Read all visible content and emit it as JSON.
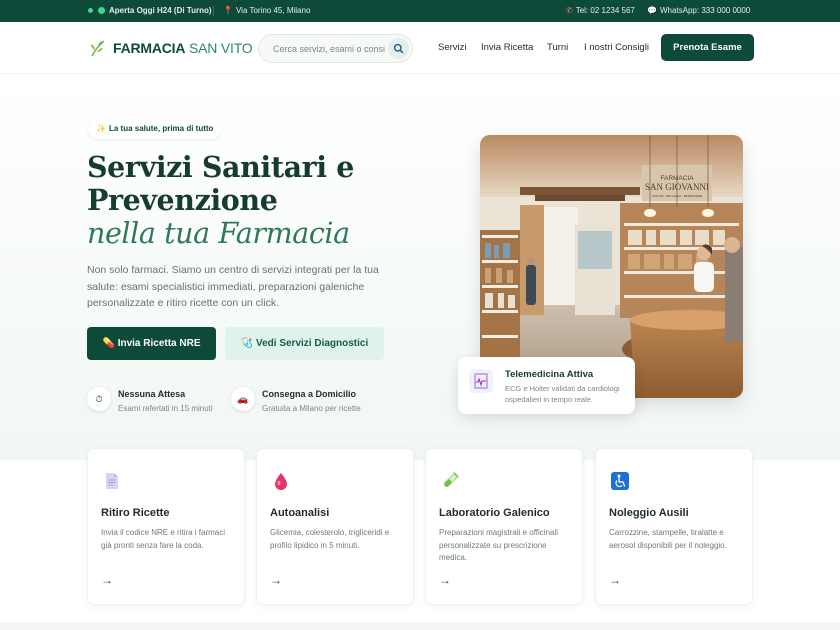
{
  "topbar": {
    "status": "Aperta Oggi H24 (Di Turno)",
    "address": "Via Torino 45, Milano",
    "phone": "Tel: 02 1234 567",
    "whatsapp": "WhatsApp: 333 000 0000"
  },
  "header": {
    "logo_bold": "FARMACIA",
    "logo_light": "SAN VITO",
    "search_placeholder": "Cerca servizi, esami o consigli...",
    "nav": [
      "Servizi",
      "Invia Ricetta",
      "Turni",
      "I nostri Consigli"
    ],
    "cta": "Prenota Esame"
  },
  "hero": {
    "pill": "La tua salute, prima di tutto",
    "title_line1": "Servizi Sanitari e",
    "title_line2": "Prevenzione",
    "title_italic": "nella tua Farmacia",
    "lead": "Non solo farmaci. Siamo un centro di servizi integrati per la tua salute: esami specialistici immediati, preparazioni galeniche personalizzate e ritiro ricette con un click.",
    "primary_button": "Invia Ricetta NRE",
    "secondary_button": "Vedi Servizi Diagnostici",
    "features": [
      {
        "title": "Nessuna Attesa",
        "subtitle": "Esami refertati in 15 minuti",
        "icon": "stopwatch-icon"
      },
      {
        "title": "Consegna a Domicilio",
        "subtitle": "Gratuita a Milano per ricette",
        "icon": "car-icon"
      }
    ],
    "photo_sign_line1": "FARMACIA",
    "photo_sign_line2": "SAN GIOVANNI",
    "photo_sign_line3": "SALUTE · BELLEZZA · BENESSERE",
    "card_title": "Telemedicina Attiva",
    "card_text": "ECG e Holter validati da cardiologi ospedalieri in tempo reale."
  },
  "services": [
    {
      "title": "Ritiro Ricette",
      "desc": "Invia il codice NRE e ritira i farmaci già pronti senza fare la coda.",
      "icon": "document-icon",
      "arrow": "→"
    },
    {
      "title": "Autoanalisi",
      "desc": "Glicemia, colesterolo, trigliceridi e profilo lipidico in 5 minuti.",
      "icon": "blood-drop-icon",
      "arrow": "→"
    },
    {
      "title": "Laboratorio Galenico",
      "desc": "Preparazioni magistrali e officinali personalizzate su prescrizione medica.",
      "icon": "test-tube-icon",
      "arrow": "→"
    },
    {
      "title": "Noleggio Ausili",
      "desc": "Carrozzine, stampelle, tiralatte e aerosol disponibili per il noleggio.",
      "icon": "wheelchair-icon",
      "arrow": "→"
    }
  ],
  "colors": {
    "brand": "#0d4a3a",
    "accent": "#2e8a5a",
    "mint": "#dff3ea"
  }
}
